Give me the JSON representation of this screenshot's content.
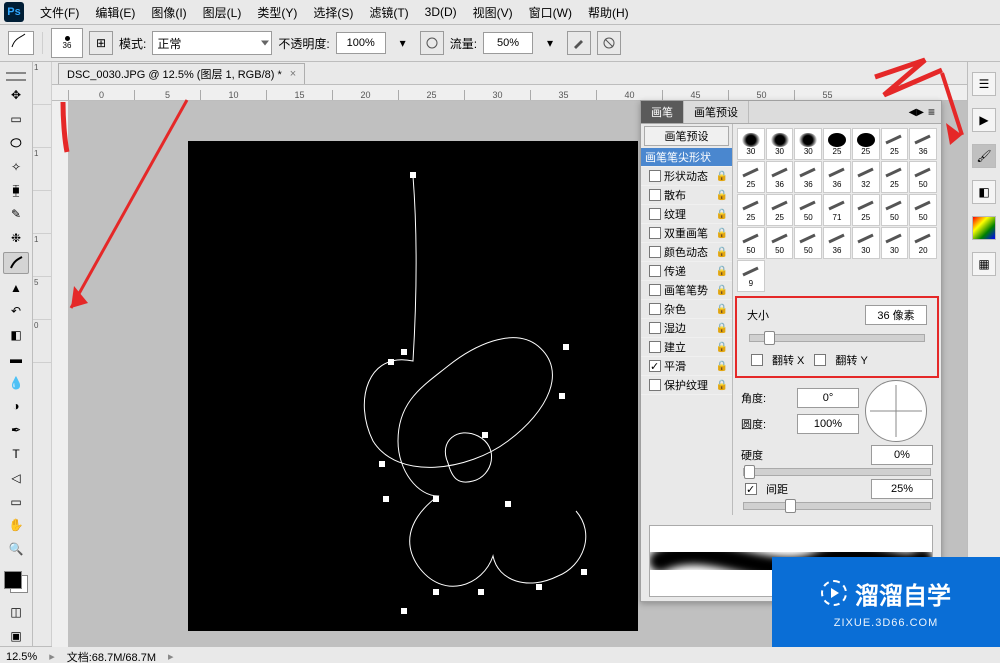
{
  "menu": {
    "file": "文件(F)",
    "edit": "编辑(E)",
    "image": "图像(I)",
    "layer": "图层(L)",
    "type": "类型(Y)",
    "select": "选择(S)",
    "filter": "滤镜(T)",
    "threeD": "3D(D)",
    "view": "视图(V)",
    "window": "窗口(W)",
    "help": "帮助(H)"
  },
  "options": {
    "brush_size": "36",
    "toggle_panel": "⊞",
    "mode_label": "模式:",
    "mode_value": "正常",
    "opacity_label": "不透明度:",
    "opacity_value": "100%",
    "flow_label": "流量:",
    "flow_value": "50%"
  },
  "doc_tab": {
    "title": "DSC_0030.JPG @ 12.5% (图层 1, RGB/8) *",
    "close": "×"
  },
  "ruler_h": [
    "0",
    "5",
    "10",
    "15",
    "20",
    "25",
    "30",
    "35",
    "40",
    "45",
    "50",
    "55"
  ],
  "status": {
    "zoom": "12.5%",
    "info": "文档:68.7M/68.7M"
  },
  "brush_panel": {
    "tab1": "画笔",
    "tab2": "画笔预设",
    "tab_close": "≡",
    "header": "画笔预设",
    "rows": [
      {
        "label": "画笔笔尖形状",
        "cb": null,
        "selected": true,
        "lock": false
      },
      {
        "label": "形状动态",
        "cb": false,
        "lock": true
      },
      {
        "label": "散布",
        "cb": false,
        "lock": true
      },
      {
        "label": "纹理",
        "cb": false,
        "lock": true
      },
      {
        "label": "双重画笔",
        "cb": false,
        "lock": true
      },
      {
        "label": "颜色动态",
        "cb": false,
        "lock": true
      },
      {
        "label": "传递",
        "cb": false,
        "lock": true
      },
      {
        "label": "画笔笔势",
        "cb": false,
        "lock": true
      },
      {
        "label": "杂色",
        "cb": false,
        "lock": true
      },
      {
        "label": "湿边",
        "cb": false,
        "lock": true
      },
      {
        "label": "建立",
        "cb": false,
        "lock": true
      },
      {
        "label": "平滑",
        "cb": true,
        "lock": true
      },
      {
        "label": "保护纹理",
        "cb": false,
        "lock": true
      }
    ],
    "thumbs": [
      30,
      30,
      30,
      25,
      25,
      25,
      36,
      25,
      36,
      36,
      36,
      32,
      25,
      50,
      25,
      25,
      50,
      71,
      25,
      50,
      50,
      50,
      50,
      50,
      36,
      30,
      30,
      20,
      9
    ],
    "size_label": "大小",
    "size_value": "36 像素",
    "flipx_label": "翻转 X",
    "flipy_label": "翻转 Y",
    "angle_label": "角度:",
    "angle_value": "0°",
    "round_label": "圆度:",
    "round_value": "100%",
    "hard_label": "硬度",
    "hard_value": "0%",
    "spacing_label": "间距",
    "spacing_value": "25%"
  },
  "badge": {
    "title": "溜溜自学",
    "sub": "ZIXUE.3D66.COM"
  }
}
